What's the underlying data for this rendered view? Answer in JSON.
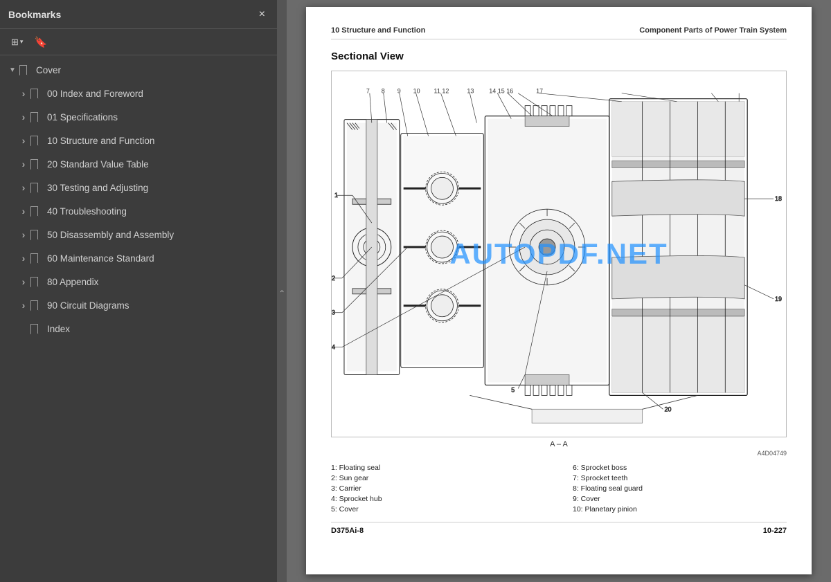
{
  "sidebar": {
    "title": "Bookmarks",
    "close_label": "×",
    "toolbar": {
      "view_btn": "☰",
      "view_dropdown": "▾",
      "bookmark_btn": "🔖"
    },
    "items": [
      {
        "id": "cover",
        "label": "Cover",
        "level": 0,
        "expanded": true,
        "has_children": true
      },
      {
        "id": "00",
        "label": "00 Index and Foreword",
        "level": 1,
        "expanded": false,
        "has_children": true
      },
      {
        "id": "01",
        "label": "01 Specifications",
        "level": 1,
        "expanded": false,
        "has_children": true
      },
      {
        "id": "10",
        "label": "10 Structure and Function",
        "level": 1,
        "expanded": false,
        "has_children": true
      },
      {
        "id": "20",
        "label": "20 Standard Value Table",
        "level": 1,
        "expanded": false,
        "has_children": true
      },
      {
        "id": "30",
        "label": "30 Testing and Adjusting",
        "level": 1,
        "expanded": false,
        "has_children": true
      },
      {
        "id": "40",
        "label": "40 Troubleshooting",
        "level": 1,
        "expanded": false,
        "has_children": true
      },
      {
        "id": "50",
        "label": "50 Disassembly and Assembly",
        "level": 1,
        "expanded": false,
        "has_children": true
      },
      {
        "id": "60",
        "label": "60 Maintenance Standard",
        "level": 1,
        "expanded": false,
        "has_children": true
      },
      {
        "id": "80",
        "label": "80 Appendix",
        "level": 1,
        "expanded": false,
        "has_children": true
      },
      {
        "id": "90",
        "label": "90 Circuit Diagrams",
        "level": 1,
        "expanded": false,
        "has_children": true
      },
      {
        "id": "index",
        "label": "Index",
        "level": 1,
        "expanded": false,
        "has_children": false
      }
    ]
  },
  "main": {
    "header_left": "10 Structure and Function",
    "header_right": "Component Parts of Power Train System",
    "section_title": "Sectional View",
    "watermark": "AUTOPDF.NET",
    "a_a_label": "A – A",
    "fig_id": "A4D04749",
    "captions": [
      {
        "left": "1: Floating seal",
        "right": "6: Sprocket boss"
      },
      {
        "left": "2: Sun gear",
        "right": "7: Sprocket teeth"
      },
      {
        "left": "3: Carrier",
        "right": "8: Floating seal guard"
      },
      {
        "left": "4: Sprocket hub",
        "right": "9: Cover"
      },
      {
        "left": "5: Cover",
        "right": "10: Planetary pinion"
      }
    ],
    "footer_left": "D375Ai-8",
    "footer_right": "10-227"
  }
}
